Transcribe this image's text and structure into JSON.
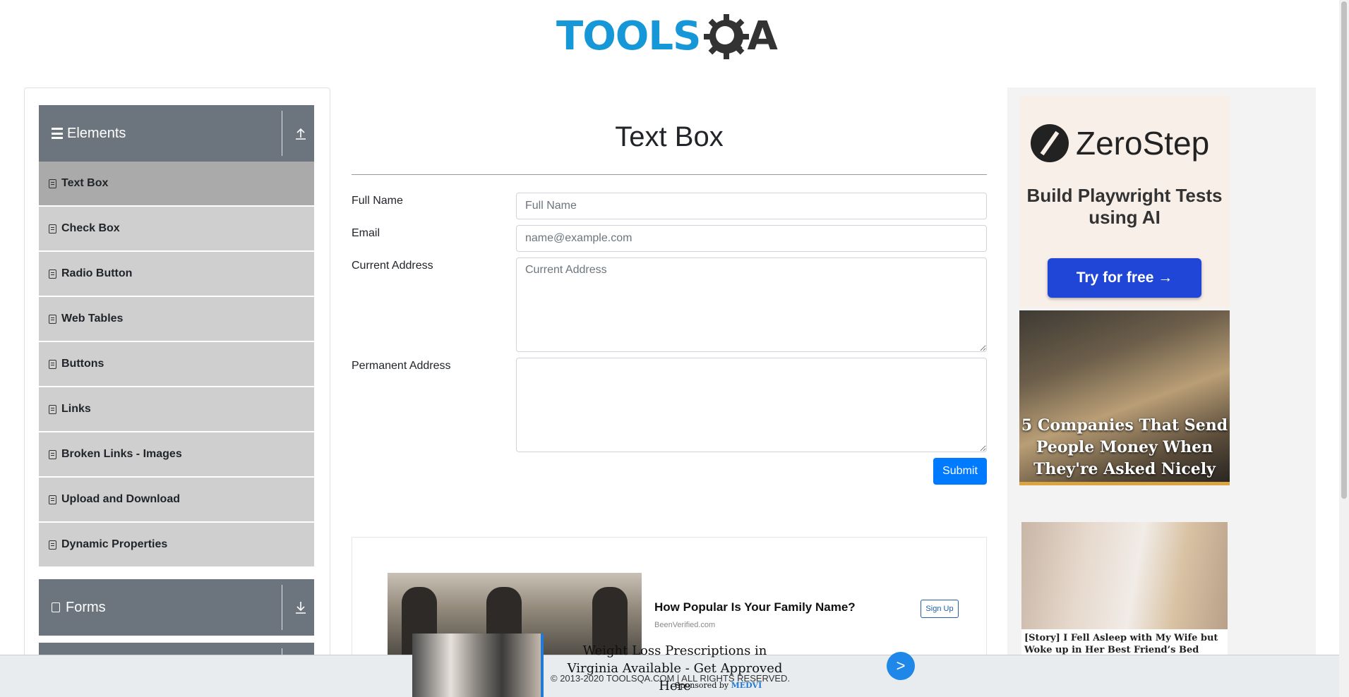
{
  "logo": {
    "tools": "TOOLS",
    "a": "A",
    "colors": {
      "tools": "#1597d8",
      "gear": "#333333"
    }
  },
  "sidebar": {
    "groups": [
      {
        "label": "Elements",
        "icon": "hamburger-icon",
        "arrow": "collapse-arrow-icon"
      },
      {
        "label": "Forms",
        "icon": "document-icon",
        "arrow": "expand-arrow-icon"
      }
    ],
    "items": [
      {
        "label": "Text Box",
        "active": true
      },
      {
        "label": "Check Box"
      },
      {
        "label": "Radio Button"
      },
      {
        "label": "Web Tables"
      },
      {
        "label": "Buttons"
      },
      {
        "label": "Links"
      },
      {
        "label": "Broken Links - Images"
      },
      {
        "label": "Upload and Download"
      },
      {
        "label": "Dynamic Properties"
      }
    ]
  },
  "main": {
    "title": "Text Box",
    "fields": {
      "full_name": {
        "label": "Full Name",
        "placeholder": "Full Name",
        "value": ""
      },
      "email": {
        "label": "Email",
        "placeholder": "name@example.com",
        "value": ""
      },
      "current_address": {
        "label": "Current Address",
        "placeholder": "Current Address",
        "value": ""
      },
      "permanent_address": {
        "label": "Permanent Address",
        "placeholder": "",
        "value": ""
      }
    },
    "submit_label": "Submit"
  },
  "ads": {
    "inline": {
      "headline": "How Popular Is Your Family Name?",
      "source": "BeenVerified.com",
      "cta": "Sign Up"
    },
    "zerostep": {
      "name": "ZeroStep",
      "tagline": "Build Playwright Tests using AI",
      "cta": "Try for free →"
    },
    "money": {
      "text": "5 Companies That Send People Money When They're Asked Nicely"
    },
    "story": {
      "text": "[Story] I Fell Asleep with My Wife but Woke up in Her Best Friend’s Bed"
    },
    "bottom": {
      "headline": "Weight Loss Prescriptions in Virginia Available - Get Approved Here",
      "sponsor_prefix": "Sponsored by",
      "sponsor_name": "MEDVI",
      "next": ">"
    }
  },
  "footer": {
    "text": "© 2013-2020 TOOLSQA.COM | ALL RIGHTS RESERVED."
  },
  "colors": {
    "primary": "#007bff",
    "sidebar_header": "#6c757d",
    "menu_item": "#cfcfcf",
    "menu_active": "#aaaaaa"
  }
}
